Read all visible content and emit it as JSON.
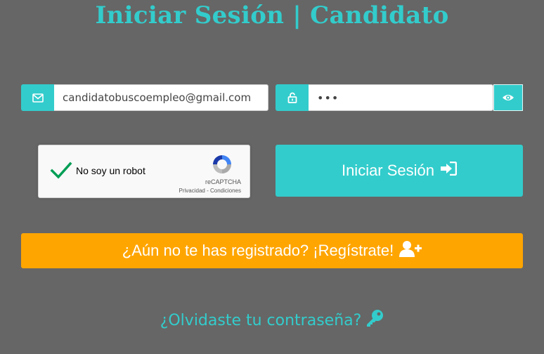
{
  "title": "Iniciar Sesión | Candidato",
  "email_field": {
    "value": "candidatobuscoempleo@gmail.com",
    "icon": "envelope-icon"
  },
  "password_field": {
    "value": "•••",
    "icon": "unlock-icon",
    "toggle_icon": "eye-icon"
  },
  "captcha": {
    "label": "No soy un robot",
    "checked": true,
    "brand": "reCAPTCHA",
    "links": "Privacidad - Condiciones"
  },
  "login_button": {
    "label": "Iniciar Sesión",
    "icon": "sign-in-icon"
  },
  "register_button": {
    "label": "¿Aún no te has registrado? ¡Regístrate!",
    "icon": "user-plus-icon"
  },
  "forgot_link": {
    "label": "¿Olvidaste tu contraseña?",
    "icon": "key-icon"
  },
  "colors": {
    "background": "#666666",
    "accent": "#33cccc",
    "register": "#ffa500"
  }
}
